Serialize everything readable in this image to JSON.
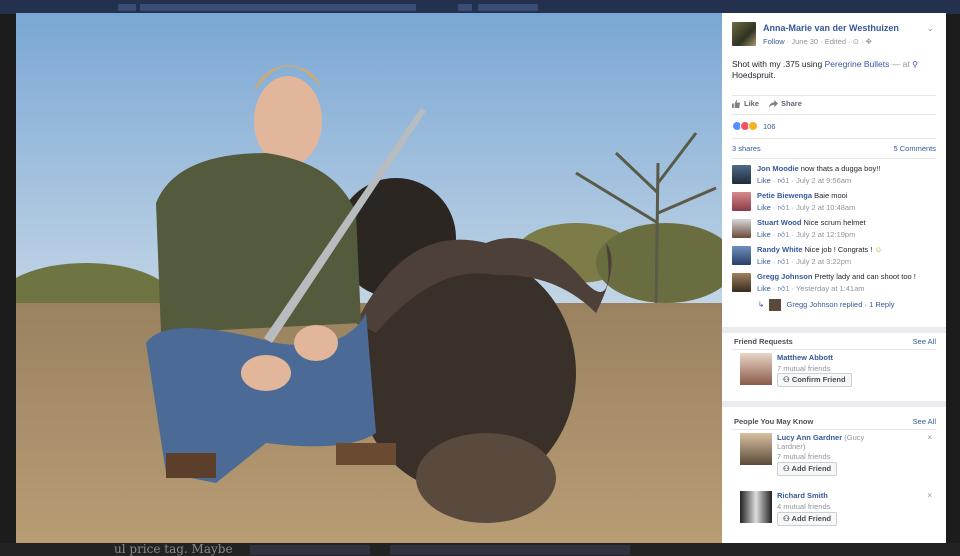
{
  "post": {
    "author": "Anna-Marie van der Westhuizen",
    "follow": "Follow",
    "date": "June 30",
    "edited": "Edited",
    "text_before": "Shot with my .375 using",
    "link_text": "Peregrine Bullets",
    "text_at": "— at",
    "location": "Hoedspruit.",
    "like_label": "Like",
    "share_label": "Share",
    "reaction_count": "106",
    "shares": "3 shares",
    "comments_count": "5 Comments"
  },
  "comments": [
    {
      "name": "Jon Moodie",
      "text": "now thats a dugga boy!!",
      "like": "Like",
      "count": "1",
      "time": "July 2 at 9:56am"
    },
    {
      "name": "Petie Biewenga",
      "text": "Baie mooi",
      "like": "Like",
      "count": "1",
      "time": "July 2 at 10:48am"
    },
    {
      "name": "Stuart Wood",
      "text": "Nice scrum helmet",
      "like": "Like",
      "count": "1",
      "time": "July 2 at 12:19pm"
    },
    {
      "name": "Randy White",
      "text": "Nice job ! Congrats !",
      "like": "Like",
      "count": "1",
      "time": "July 2 at 3:22pm"
    },
    {
      "name": "Gregg Johnson",
      "text": "Pretty lady and can shoot too !",
      "like": "Like",
      "count": "1",
      "time": "Yesterday at 1:41am"
    }
  ],
  "reply": {
    "name": "Gregg Johnson",
    "text": "replied",
    "count": "1 Reply"
  },
  "friend_requests": {
    "title": "Friend Requests",
    "see_all": "See All",
    "items": [
      {
        "name": "Matthew Abbott",
        "mutual": "7 mutual friends",
        "button": "Confirm Friend"
      }
    ]
  },
  "people_you_may_know": {
    "title": "People You May Know",
    "see_all": "See All",
    "items": [
      {
        "name": "Lucy Ann Gardner",
        "alt_name": "(Gucy",
        "alt_name2": "Lardner)",
        "mutual": "7 mutual friends",
        "button": "Add Friend"
      },
      {
        "name": "Richard Smith",
        "mutual": "4 mutual friends",
        "button": "Add Friend"
      }
    ]
  },
  "background": {
    "bottom_text": "ul price tag. Maybe"
  },
  "icons": {
    "close": "×",
    "chevron": "⌄",
    "reply_arrow": "↳"
  }
}
